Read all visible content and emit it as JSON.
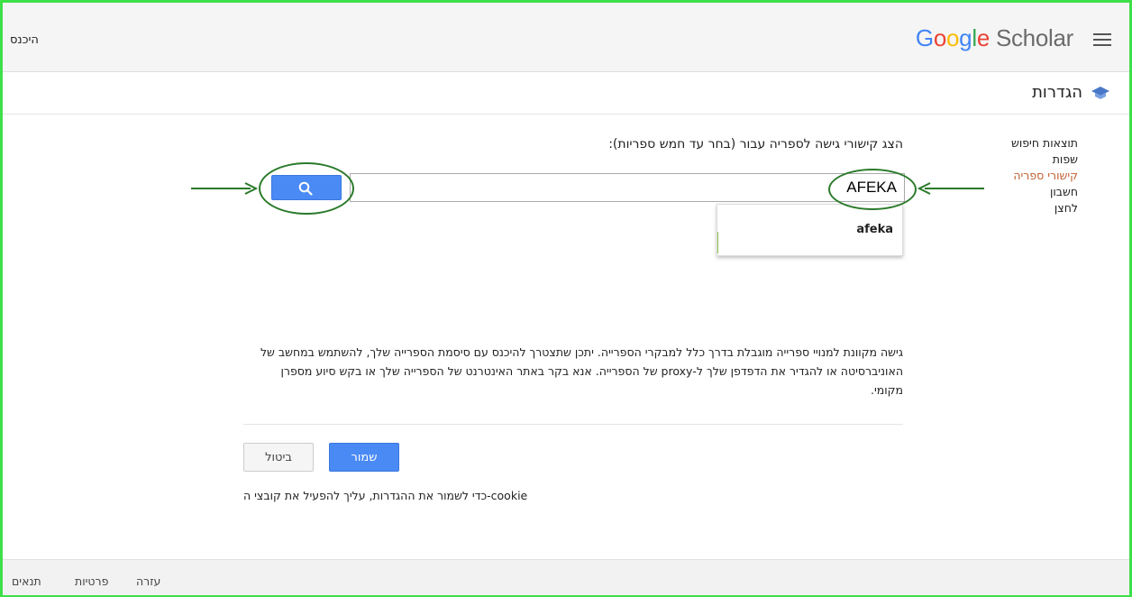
{
  "header": {
    "sign_in": "היכנס",
    "logo_google": "Google",
    "logo_scholar": "Scholar"
  },
  "settings": {
    "title": "הגדרות",
    "nav": [
      {
        "label": "תוצאות חיפוש",
        "active": false
      },
      {
        "label": "שפות",
        "active": false
      },
      {
        "label": "קישורי ספריה",
        "active": true
      },
      {
        "label": "חשבון",
        "active": false
      },
      {
        "label": "לחצן",
        "active": false
      }
    ]
  },
  "library": {
    "prompt": "הצג קישורי גישה לספריה עבור (בחר עד חמש ספריות):",
    "search_value": "AFEKA",
    "suggestion": "afeka",
    "info": "גישה מקוונת למנויי ספרייה מוגבלת בדרך כלל למבקרי הספרייה. יתכן שתצטרך להיכנס עם סיסמת הספרייה שלך, להשתמש במחשב של האוניברסיטה או להגדיר את הדפדפן שלך ל-proxy של הספרייה. אנא בקר באתר האינטרנט של הספרייה שלך או בקש סיוע מספרן מקומי."
  },
  "actions": {
    "save": "שמור",
    "cancel": "ביטול",
    "cookie_note": "כדי לשמור את ההגדרות, עליך להפעיל את קובצי ה-cookie"
  },
  "footer": {
    "help": "עזרה",
    "privacy": "פרטיות",
    "terms": "תנאים"
  },
  "colors": {
    "frame": "#3ee04a",
    "accent_blue": "#4a8af4",
    "active_link": "#c06030",
    "annotation": "#2a7a2a"
  },
  "icons": [
    "menu-icon",
    "graduation-cap-icon",
    "search-icon",
    "arrow-right-icon",
    "arrow-left-icon"
  ]
}
